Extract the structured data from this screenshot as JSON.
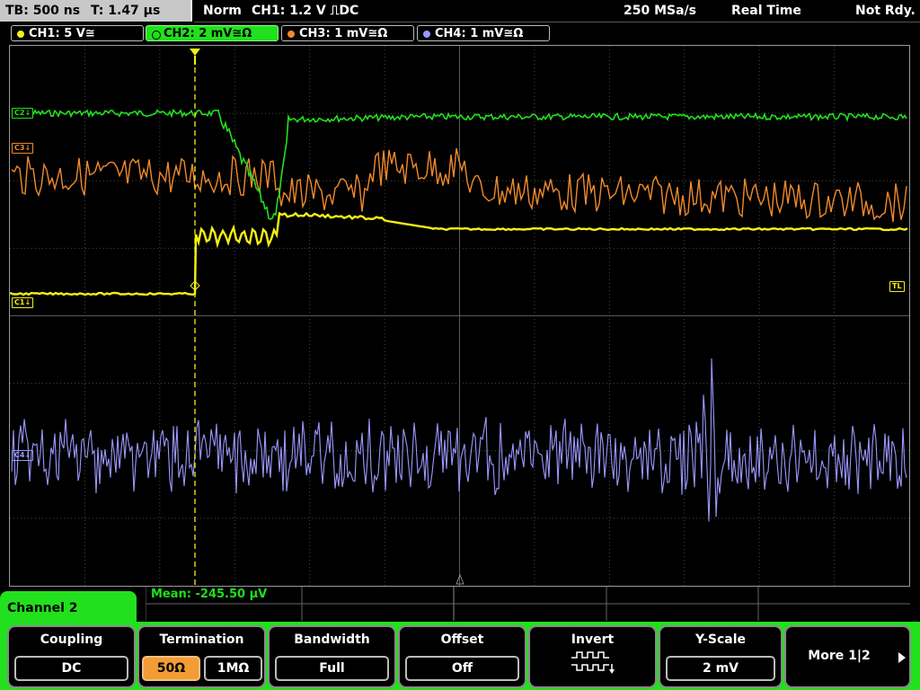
{
  "status_bar": {
    "timebase": "TB: 500 ns",
    "trigger_time": "T: 1.47 µs",
    "trigger_mode": "Norm",
    "trigger_info": "CH1: 1.2 V ⎍DC",
    "sample_rate": "250 MSa/s",
    "acquisition_mode": "Real Time",
    "trigger_state": "Not Rdy."
  },
  "channels": [
    {
      "label": "CH1: 5 V≅",
      "color": "#f3f012",
      "active": false
    },
    {
      "label": "CH2: 2 mV≅Ω",
      "color": "#22e01e",
      "active": true
    },
    {
      "label": "CH3: 1 mV≅Ω",
      "color": "#f08a2b",
      "active": false
    },
    {
      "label": "CH4: 1 mV≅Ω",
      "color": "#9b98ff",
      "active": false
    }
  ],
  "plot": {
    "markers": {
      "ch1": "C1↓",
      "ch2": "C2↓",
      "ch3": "C3↓",
      "ch4": "C4↓",
      "trigger_level": "TL"
    },
    "grid_color": "#4a4a4a",
    "trigger_marker_color": "#f3f012"
  },
  "measurement": {
    "text": "Mean: -245.50 µV"
  },
  "menu": {
    "title": "Channel 2",
    "coupling": {
      "title": "Coupling",
      "value": "DC"
    },
    "termination": {
      "title": "Termination",
      "option_a": "50Ω",
      "option_b": "1MΩ",
      "selected": "50Ω"
    },
    "bandwidth": {
      "title": "Bandwidth",
      "value": "Full"
    },
    "offset": {
      "title": "Offset",
      "value": "Off"
    },
    "invert": {
      "title": "Invert",
      "icon": "invert-waveform-icon"
    },
    "yscale": {
      "title": "Y-Scale",
      "value": "2 mV"
    },
    "more": {
      "label": "More 1|2",
      "icon": "arrow-right-icon"
    }
  }
}
